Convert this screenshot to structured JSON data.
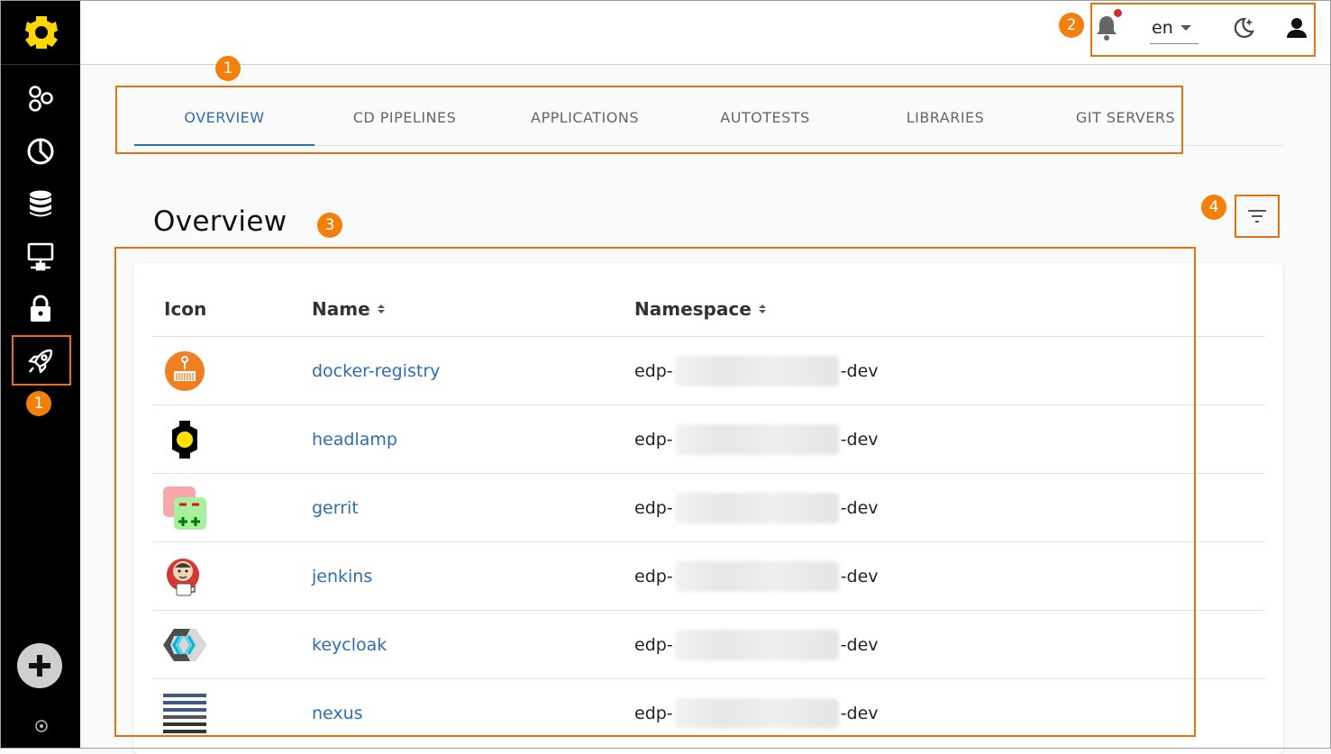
{
  "sidebar": {
    "items": [
      {
        "name": "overview",
        "icon": "components-icon"
      },
      {
        "name": "dashboard",
        "icon": "pie-chart-icon"
      },
      {
        "name": "storage",
        "icon": "database-icon"
      },
      {
        "name": "network",
        "icon": "network-icon"
      },
      {
        "name": "security",
        "icon": "lock-icon"
      },
      {
        "name": "deploy",
        "icon": "rocket-icon",
        "active": true
      }
    ],
    "add_icon": "plus-icon"
  },
  "topbar": {
    "language": "en",
    "icons": [
      "bell-icon",
      "theme-moon-icon",
      "user-icon"
    ]
  },
  "tabs": [
    {
      "label": "OVERVIEW",
      "active": true
    },
    {
      "label": "CD PIPELINES"
    },
    {
      "label": "APPLICATIONS"
    },
    {
      "label": "AUTOTESTS"
    },
    {
      "label": "LIBRARIES"
    },
    {
      "label": "GIT SERVERS"
    }
  ],
  "page": {
    "title": "Overview",
    "filter_icon": "filter-icon"
  },
  "table": {
    "columns": [
      "Icon",
      "Name",
      "Namespace"
    ],
    "rows": [
      {
        "name": "docker-registry",
        "ns_prefix": "edp-",
        "ns_suffix": "-dev"
      },
      {
        "name": "headlamp",
        "ns_prefix": "edp-",
        "ns_suffix": "-dev"
      },
      {
        "name": "gerrit",
        "ns_prefix": "edp-",
        "ns_suffix": "-dev"
      },
      {
        "name": "jenkins",
        "ns_prefix": "edp-",
        "ns_suffix": "-dev"
      },
      {
        "name": "keycloak",
        "ns_prefix": "edp-",
        "ns_suffix": "-dev"
      },
      {
        "name": "nexus",
        "ns_prefix": "edp-",
        "ns_suffix": "-dev"
      }
    ]
  },
  "annotations": [
    "1",
    "1",
    "2",
    "3",
    "4"
  ],
  "colors": {
    "accent": "#2f6db0",
    "annotation": "#f4800c",
    "sidebar_bg": "#000000",
    "logo": "#ffd600"
  }
}
